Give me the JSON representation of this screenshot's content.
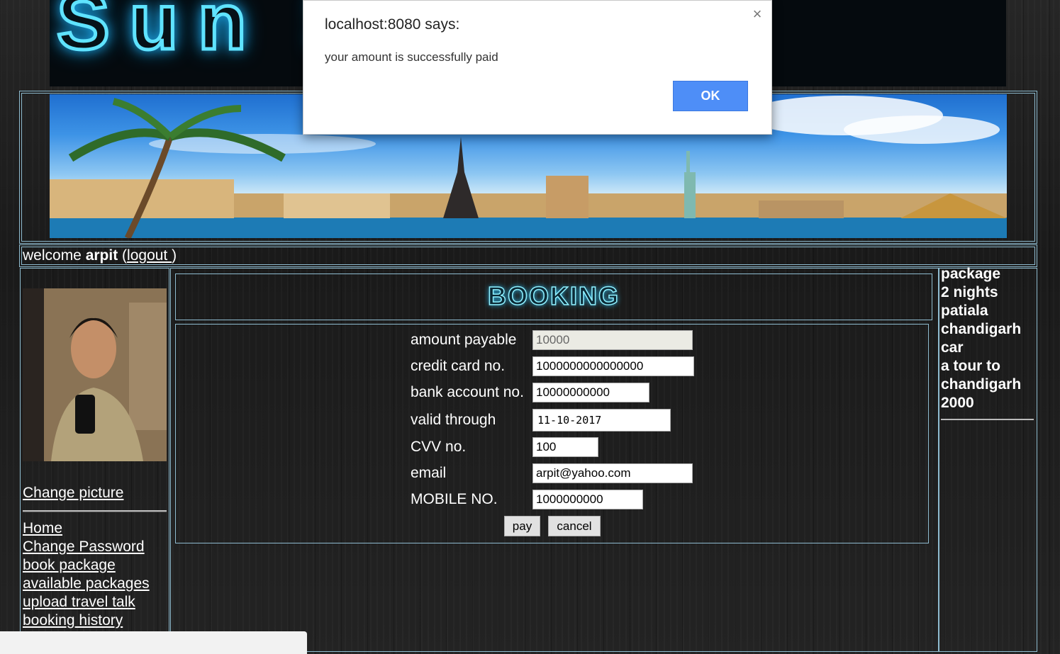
{
  "dialog": {
    "title": "localhost:8080 says:",
    "message": "your amount is successfully paid",
    "ok_label": "OK",
    "close_icon": "×"
  },
  "header": {
    "logo_text": "Sun Safar"
  },
  "welcome": {
    "prefix": "welcome ",
    "username": "arpit",
    "open_paren": " (",
    "logout_label": "logout ",
    "close_paren": ")"
  },
  "sidebar": {
    "change_picture": "Change picture",
    "links": [
      "Home ",
      "Change Password",
      "book package ",
      "available packages",
      "upload travel talk",
      "booking history"
    ]
  },
  "booking": {
    "title": "BOOKING",
    "fields": [
      {
        "label": "amount payable",
        "value": "10000"
      },
      {
        "label": "credit card no.",
        "value": "1000000000000000"
      },
      {
        "label": "bank account no.",
        "value": "10000000000"
      },
      {
        "label": "valid through",
        "value": "11-10-2017"
      },
      {
        "label": "CVV no.",
        "value": "100"
      },
      {
        "label": "email",
        "value": "arpit@yahoo.com"
      },
      {
        "label": "MOBILE NO.",
        "value": "1000000000"
      }
    ],
    "pay_label": "pay",
    "cancel_label": "cancel"
  },
  "package": {
    "lines": [
      "package",
      "2 nights",
      "patiala",
      "chandigarh",
      "car",
      "a tour to",
      "chandigarh",
      "2000"
    ]
  },
  "colors": {
    "frame": "#8fbcd0",
    "ok_button": "#4e8ef7",
    "logo_glow": "#5fe3ff"
  }
}
